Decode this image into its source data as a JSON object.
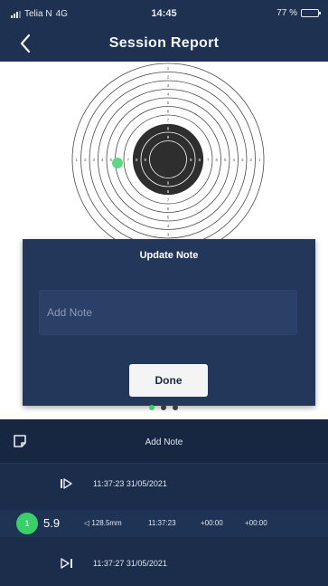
{
  "status_bar": {
    "carrier": "Telia N",
    "network": "4G",
    "time": "14:45",
    "battery_text": "77 %",
    "battery_level": 0.77
  },
  "nav": {
    "title": "Session Report",
    "back_icon": "chevron-left-icon"
  },
  "target": {
    "ring_numbers": [
      "1",
      "2",
      "3",
      "4",
      "5",
      "6",
      "7",
      "8",
      "9"
    ],
    "shot_marker_color": "#3bcf6b"
  },
  "modal": {
    "title": "Update Note",
    "input_placeholder": "Add Note",
    "input_value": "",
    "done_label": "Done"
  },
  "pager": {
    "count": 3,
    "active_index": 0,
    "active_color": "#3bcf6b"
  },
  "panel": {
    "add_note_icon": "note-icon",
    "add_note_label": "Add Note",
    "session_start": {
      "icon": "play-start-icon",
      "timestamp": "11:37:23 31/05/2021"
    },
    "shot": {
      "number": "1",
      "score": "5.9",
      "distance": "◁ 128.5mm",
      "time": "11:37:23",
      "offset_a": "+00:00",
      "offset_b": "+00:00"
    },
    "session_end": {
      "icon": "play-end-icon",
      "timestamp": "11:37:27 31/05/2021"
    }
  },
  "colors": {
    "header_bg": "#1e3151",
    "modal_bg": "#23375a",
    "panel_bg": "#1b2d4b",
    "accent_green": "#3bcf6b"
  }
}
